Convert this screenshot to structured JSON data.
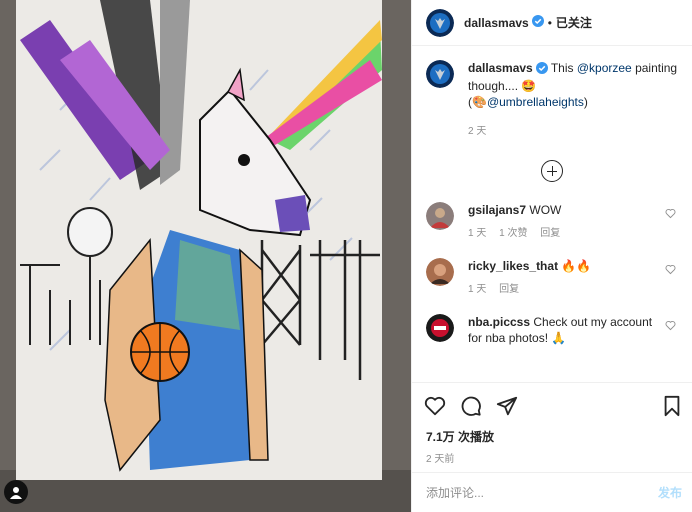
{
  "post": {
    "author": "dallasmavs",
    "follow_status": "已关注",
    "separator": "•",
    "caption": {
      "prefix": "This ",
      "mention1": "@kporzee",
      "middle": " painting though.... 🤩",
      "paren_open": "(🎨",
      "mention2": "@umbrellaheights",
      "paren_close": ")",
      "age": "2 天"
    },
    "comments": [
      {
        "user": "gsilajans7",
        "text": "WOW",
        "age": "1 天",
        "likes": "1 次赞",
        "reply": "回复",
        "avatar_color": "#8b7d7b"
      },
      {
        "user": "ricky_likes_that",
        "text": "🔥🔥",
        "age": "1 天",
        "likes": "",
        "reply": "回复",
        "avatar_color": "#a86d4d"
      },
      {
        "user": "nba.piccss",
        "text": "Check out my account for nba photos! 🙏",
        "age": "",
        "likes": "",
        "reply": "",
        "avatar_color": "#c8102e"
      }
    ],
    "like_count": "7.1万 次播放",
    "posted": "2 天前",
    "comment_placeholder": "添加评论...",
    "post_button": "发布",
    "colors": {
      "brand_blue": "#0095f6",
      "link": "#00376b",
      "muted": "#8e8e8e"
    }
  }
}
